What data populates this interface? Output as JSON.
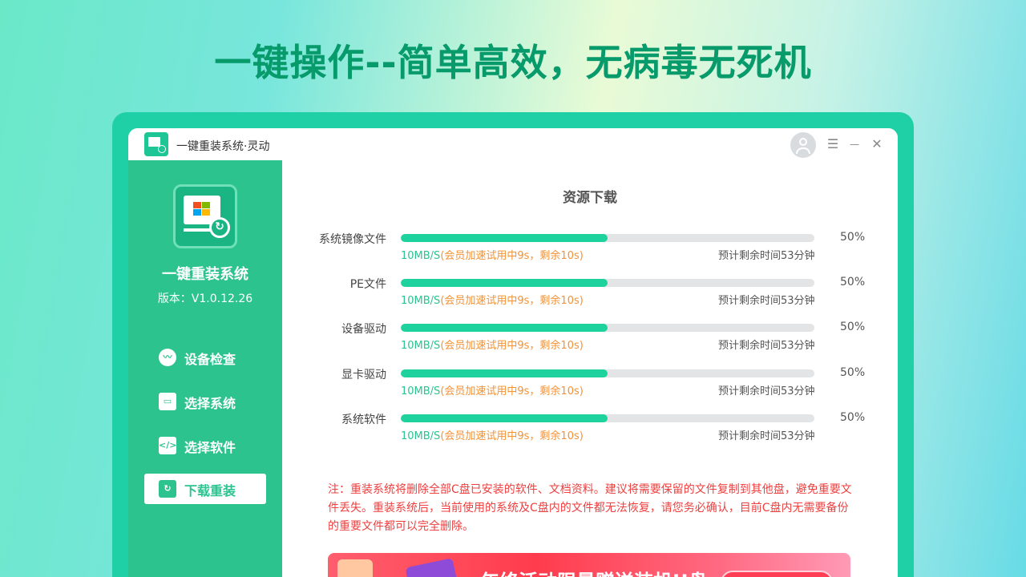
{
  "headline": "一键操作--简单高效，无病毒无死机",
  "window": {
    "title": "一键重装系统·灵动",
    "controls": {
      "menu": "☰",
      "minimize": "—",
      "close": "✕"
    }
  },
  "sidebar": {
    "app_name": "一键重装系统",
    "version": "版本：V1.0.12.26",
    "items": [
      {
        "label": "设备检查",
        "icon": "pulse-icon",
        "active": false
      },
      {
        "label": "选择系统",
        "icon": "monitor-icon",
        "active": false
      },
      {
        "label": "选择软件",
        "icon": "code-window-icon",
        "active": false
      },
      {
        "label": "下载重装",
        "icon": "refresh-icon",
        "active": true
      }
    ]
  },
  "main": {
    "title": "资源下载",
    "downloads": [
      {
        "name": "系统镜像文件",
        "progress": 0.5,
        "percent": "50%",
        "speed": "10MB/S",
        "promo": "(会员加速试用中9s，剩余10s)",
        "eta": "预计剩余时间53分钟"
      },
      {
        "name": "PE文件",
        "progress": 0.5,
        "percent": "50%",
        "speed": "10MB/S",
        "promo": "(会员加速试用中9s，剩余10s)",
        "eta": "预计剩余时间53分钟"
      },
      {
        "name": "设备驱动",
        "progress": 0.5,
        "percent": "50%",
        "speed": "10MB/S",
        "promo": "(会员加速试用中9s，剩余10s)",
        "eta": "预计剩余时间53分钟"
      },
      {
        "name": "显卡驱动",
        "progress": 0.5,
        "percent": "50%",
        "speed": "10MB/S",
        "promo": "(会员加速试用中9s，剩余10s)",
        "eta": "预计剩余时间53分钟"
      },
      {
        "name": "系统软件",
        "progress": 0.5,
        "percent": "50%",
        "speed": "10MB/S",
        "promo": "(会员加速试用中9s，剩余10s)",
        "eta": "预计剩余时间53分钟"
      }
    ],
    "note": "注：重装系统将删除全部C盘已安装的软件、文档资料。建议将需要保留的文件复制到其他盘，避免重要文件丢失。重装系统后，当前使用的系统及C盘内的文件都无法恢复，请您务必确认，目前C盘内无需要备份的重要文件都可以完全删除。",
    "banner_text": "年终活动限量赠送装机U盘"
  },
  "colors": {
    "accent": "#2cc38f",
    "progress": "#1ed29d",
    "promo": "#f59233",
    "warning": "#ef3f3f",
    "headline": "#079a6a"
  }
}
